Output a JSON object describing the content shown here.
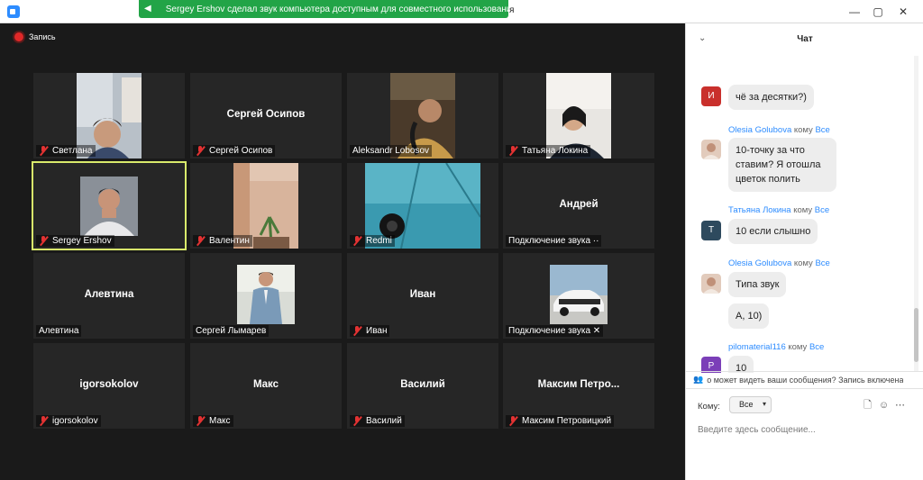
{
  "notification": "Sergey Ershov сделал звук компьютера доступным для совместного использования",
  "window": {
    "title_fragment": "я",
    "minimize": "—",
    "maximize": "▢",
    "close": "✕"
  },
  "recording": {
    "label": "Запись"
  },
  "tiles": [
    {
      "name": "Светлана",
      "center": "",
      "muted": true
    },
    {
      "name": "Сергей Осипов",
      "center": "Сергей Осипов",
      "muted": true
    },
    {
      "name": "Aleksandr Lobosov",
      "center": "",
      "muted": false
    },
    {
      "name": "Татьяна Локина",
      "center": "",
      "muted": true
    },
    {
      "name": "Sergey Ershov",
      "center": "",
      "muted": true,
      "active": true
    },
    {
      "name": "Валентин",
      "center": "",
      "muted": true
    },
    {
      "name": "Redmi",
      "center": "",
      "muted": true
    },
    {
      "name": "Подключение звука ··",
      "center": "Андрей",
      "muted": false
    },
    {
      "name": "Алевтина",
      "center": "Алевтина",
      "muted": false
    },
    {
      "name": "Сергей Лымарев",
      "center": "",
      "muted": false
    },
    {
      "name": "Иван",
      "center": "Иван",
      "muted": true
    },
    {
      "name": "Подключение звука ✕",
      "center": "",
      "muted": false
    },
    {
      "name": "igorsokolov",
      "center": "igorsokolov",
      "muted": true
    },
    {
      "name": "Макс",
      "center": "Макс",
      "muted": true
    },
    {
      "name": "Василий",
      "center": "Василий",
      "muted": true
    },
    {
      "name": "Максим Петровицкий",
      "center": "Максим  Петро...",
      "muted": true
    }
  ],
  "chat": {
    "title": "Чат",
    "collapse_icon": "chevron-down-icon",
    "to_word": "кому",
    "messages": [
      {
        "sender": "",
        "recipient": "",
        "initial": "И",
        "avatar_color": "#c9302c",
        "text": "чё за десятки?)"
      },
      {
        "sender": "Olesia Golubova",
        "recipient": "Все",
        "initial": "",
        "avatar_color": "#d8b8a8",
        "text": "10-точку за что ставим? Я отошла цветок полить"
      },
      {
        "sender": "Татьяна Локина",
        "recipient": "Все",
        "initial": "Т",
        "avatar_color": "#2e4a5e",
        "text": "10 если слышно"
      },
      {
        "sender": "Olesia Golubova",
        "recipient": "Все",
        "initial": "",
        "avatar_color": "#d8b8a8",
        "text": "Типа звук"
      },
      {
        "sender": "",
        "recipient": "",
        "initial": "",
        "avatar_color": "",
        "text": "А, 10)"
      },
      {
        "sender": "pilomaterial116",
        "recipient": "Все",
        "initial": "P",
        "avatar_color": "#7b3fb8",
        "text": "10"
      }
    ],
    "privacy_text": "о может видеть ваши сообщения? Запись включена",
    "to_label": "Кому:",
    "to_value": "Все",
    "input_placeholder": "Введите здесь сообщение..."
  }
}
